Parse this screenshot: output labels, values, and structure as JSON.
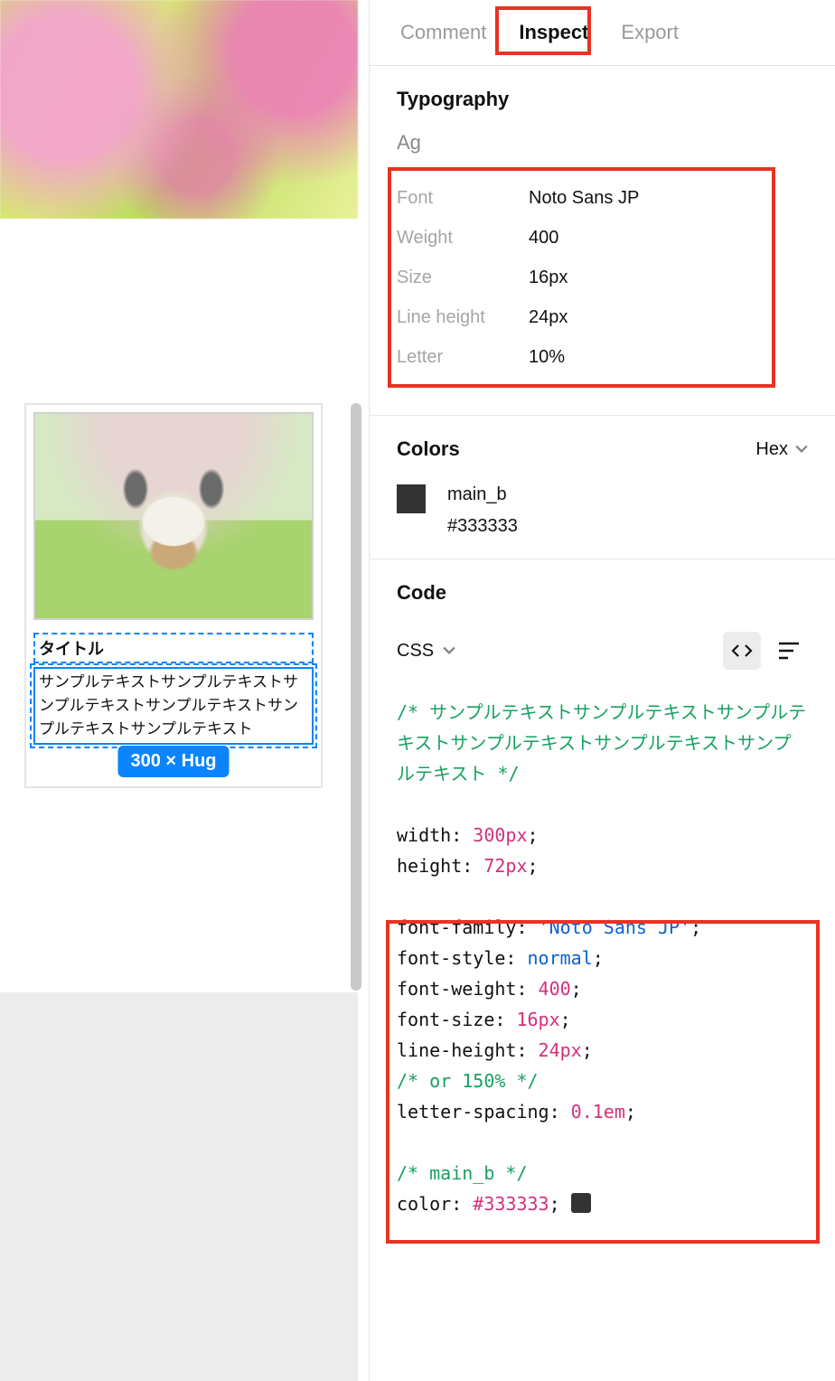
{
  "tabs": {
    "comment": "Comment",
    "inspect": "Inspect",
    "export": "Export"
  },
  "typography": {
    "heading": "Typography",
    "sample": "Ag",
    "rows": {
      "font": {
        "k": "Font",
        "v": "Noto Sans JP"
      },
      "weight": {
        "k": "Weight",
        "v": "400"
      },
      "size": {
        "k": "Size",
        "v": "16px"
      },
      "lh": {
        "k": "Line height",
        "v": "24px"
      },
      "letter": {
        "k": "Letter",
        "v": "10%"
      }
    }
  },
  "colors": {
    "heading": "Colors",
    "format": "Hex",
    "item": {
      "name": "main_b",
      "hex": "#333333"
    }
  },
  "code": {
    "heading": "Code",
    "lang": "CSS",
    "comment1": "/* サンプルテキストサンプルテキストサンプルテキストサンプルテキストサンプルテキストサンプルテキスト */",
    "width_prop": "width:",
    "width_val": "300px",
    "height_prop": "height:",
    "height_val": "72px",
    "ff_prop": "font-family:",
    "ff_val": "'Noto Sans JP'",
    "fs_prop": "font-style:",
    "fs_val": "normal",
    "fw_prop": "font-weight:",
    "fw_val": "400",
    "fz_prop": "font-size:",
    "fz_val": "16px",
    "lh_prop": "line-height:",
    "lh_val": "24px",
    "lh_comment": "/* or 150% */",
    "ls_prop": "letter-spacing:",
    "ls_val": "0.1em",
    "mainb_comment": "/* main_b */",
    "color_prop": "color:",
    "color_val": "#333333"
  },
  "canvas": {
    "title": "タイトル",
    "body": "サンプルテキストサンプルテキストサンプルテキストサンプルテキストサンプルテキストサンプルテキスト",
    "dim": "300 × Hug"
  }
}
